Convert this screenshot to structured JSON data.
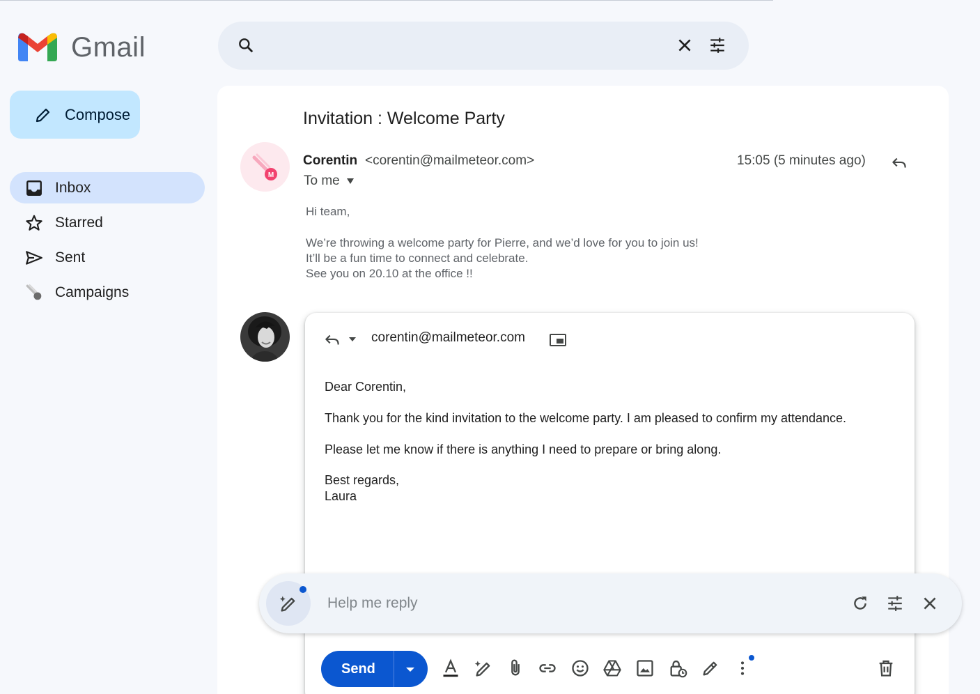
{
  "app": {
    "name": "Gmail"
  },
  "search": {
    "placeholder": "",
    "icons": [
      "search-icon",
      "clear-icon",
      "filter-options-icon"
    ]
  },
  "compose": {
    "label": "Compose"
  },
  "nav": [
    {
      "label": "Inbox",
      "icon": "inbox-icon",
      "active": true
    },
    {
      "label": "Starred",
      "icon": "star-icon",
      "active": false
    },
    {
      "label": "Sent",
      "icon": "send-icon",
      "active": false
    },
    {
      "label": "Campaigns",
      "icon": "meteor-icon",
      "active": false
    }
  ],
  "email": {
    "subject": "Invitation : Welcome Party",
    "sender_name": "Corentin",
    "sender_email": "<corentin@mailmeteor.com>",
    "recipient": "To me",
    "timestamp": "15:05 (5 minutes ago)",
    "body": [
      "Hi team,",
      "We’re throwing a welcome party for Pierre, and we’d love for you to join us!",
      "It’ll be a fun time to connect and celebrate.",
      "See you on 20.10 at the office !!"
    ]
  },
  "reply": {
    "to": "corentin@mailmeteor.com",
    "body": [
      "Dear Corentin,",
      "Thank you for the kind invitation to the welcome party. I am pleased to confirm my attendance.",
      "Please let me know if there is anything I need to prepare or bring along.",
      "Best regards,",
      "Laura"
    ]
  },
  "help_me_reply": {
    "placeholder": "Help me reply",
    "icons": [
      "magic-pen-icon",
      "refresh-icon",
      "tune-icon",
      "close-icon"
    ]
  },
  "toolbar": {
    "send_label": "Send",
    "icons": [
      "text-format-icon",
      "magic-pen-icon",
      "attach-icon",
      "link-icon",
      "emoji-icon",
      "drive-icon",
      "image-icon",
      "confidential-lock-icon",
      "signature-icon",
      "more-options-icon",
      "delete-icon"
    ]
  },
  "colors": {
    "background": "#f6f8fc",
    "compose_bg": "#c2e7ff",
    "nav_active_bg": "#d3e3fd",
    "send_button": "#0b57d0",
    "search_bg": "#e9eef6"
  }
}
